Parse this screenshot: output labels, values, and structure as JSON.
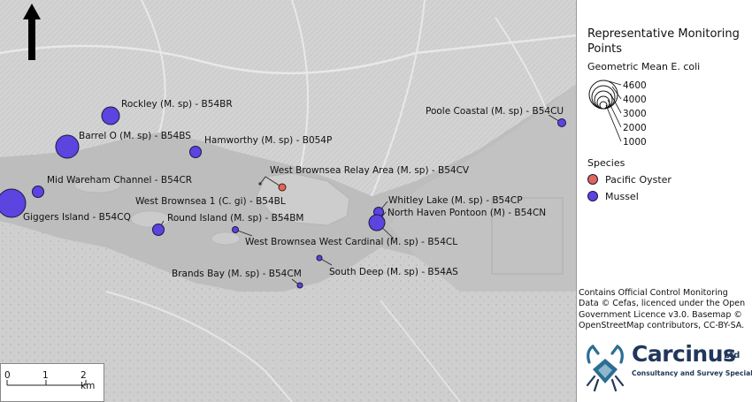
{
  "legend": {
    "title": "Representative Monitoring Points",
    "size_title": "Geometric Mean E. coli",
    "size_values": [
      "4600",
      "4000",
      "3000",
      "2000",
      "1000"
    ],
    "species_title": "Species",
    "species": [
      {
        "label": "Pacific Oyster",
        "color": "#e0655a"
      },
      {
        "label": "Mussel",
        "color": "#5b44e0"
      }
    ]
  },
  "credit": "Contains Official Control Monitoring Data © Cefas, licenced under the Open Government Licence v3.0. Basemap © OpenStreetMap contributors, CC-BY-SA.",
  "scale_bar": {
    "labels": [
      "0",
      "1",
      "2 km"
    ]
  },
  "logo": {
    "name": "Carcinus",
    "suffix": "Ltd",
    "tagline": "Consultancy and Survey Specialists"
  },
  "north_arrow": {
    "icon": "north-arrow-icon"
  },
  "sites": [
    {
      "label": "Rockley (M. sp) - B54BR",
      "species": "Mussel",
      "size": "large"
    },
    {
      "label": "Barrel O (M. sp) - B54BS",
      "species": "Mussel",
      "size": "large"
    },
    {
      "label": "Hamworthy (M. sp) - B054P",
      "species": "Mussel",
      "size": "small"
    },
    {
      "label": "Poole Coastal (M. sp) - B54CU",
      "species": "Mussel",
      "size": "small"
    },
    {
      "label": "West Brownsea Relay Area (M. sp) - B54CV",
      "species": "Pacific Oyster",
      "size": "small"
    },
    {
      "label": "Mid Wareham Channel - B54CR",
      "species": "Mussel",
      "size": "small"
    },
    {
      "label": "Giggers Island - B54CQ",
      "species": "Mussel",
      "size": "large"
    },
    {
      "label": "West Brownsea 1 (C. gi) - B54BL",
      "species": "Pacific Oyster",
      "size": "tiny"
    },
    {
      "label": "Whitley Lake (M. sp) - B54CP",
      "species": "Mussel",
      "size": "small"
    },
    {
      "label": "North Haven Pontoon (M) - B54CN",
      "species": "Mussel",
      "size": "large"
    },
    {
      "label": "Round Island (M. sp) - B54BM",
      "species": "Mussel",
      "size": "small"
    },
    {
      "label": "West Brownsea West Cardinal (M. sp) - B54CL",
      "species": "Mussel",
      "size": "tiny"
    },
    {
      "label": "South Deep (M. sp) - B54AS",
      "species": "Mussel",
      "size": "tiny"
    },
    {
      "label": "Brands Bay (M. sp) - B54CM",
      "species": "Mussel",
      "size": "tiny"
    }
  ]
}
